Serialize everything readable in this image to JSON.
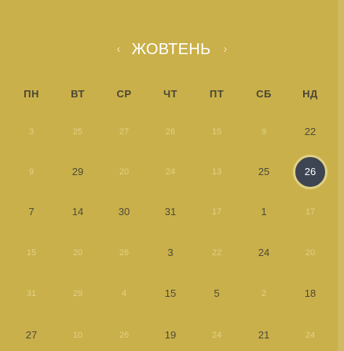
{
  "header": {
    "prev_icon": "‹",
    "month": "ЖОВТЕНЬ",
    "next_icon": "›"
  },
  "weekdays": [
    "ПН",
    "ВТ",
    "СР",
    "ЧТ",
    "ПТ",
    "СБ",
    "НД"
  ],
  "rows": [
    [
      "3",
      "25",
      "27",
      "26",
      "15",
      "9",
      "22"
    ],
    [
      "9",
      "29",
      "20",
      "24",
      "13",
      "25",
      "26"
    ],
    [
      "7",
      "14",
      "30",
      "31",
      "17",
      "1",
      "17"
    ],
    [
      "15",
      "20",
      "26",
      "3",
      "22",
      "24",
      "20"
    ],
    [
      "31",
      "29",
      "4",
      "15",
      "5",
      "2",
      "18"
    ],
    [
      "27",
      "10",
      "26",
      "19",
      "24",
      "21",
      "24"
    ]
  ],
  "selected_day": "26",
  "colors": {
    "background": "#c9b04a",
    "selected": "#3d4452",
    "text": "#4f4a3a",
    "muted": "#e3d186"
  }
}
